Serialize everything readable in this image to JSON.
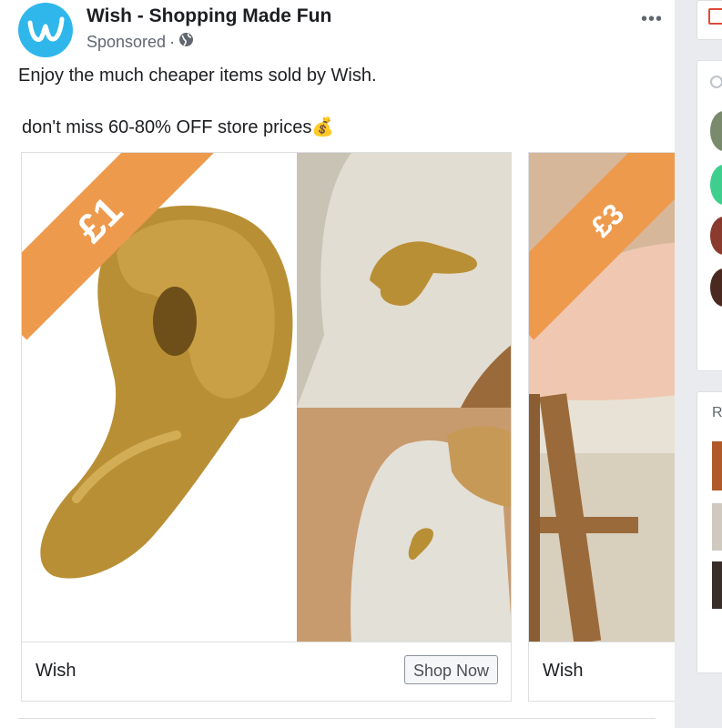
{
  "post": {
    "page_name": "Wish - Shopping Made Fun",
    "sponsored": "Sponsored",
    "separator": "·",
    "text_line1": "Enjoy the much cheaper items sold by Wish.",
    "text_line2": "don't miss 60-80% OFF store prices",
    "emoji": "💰",
    "more_label": "•••"
  },
  "carousel": [
    {
      "price": "£1",
      "label": "Wish",
      "cta": "Shop Now"
    },
    {
      "price": "£3",
      "label": "Wish"
    }
  ],
  "right_rail": {
    "section_letter": "R"
  },
  "colors": {
    "brand": "#2fb7ec",
    "price_banner": "#ee9a4d"
  }
}
